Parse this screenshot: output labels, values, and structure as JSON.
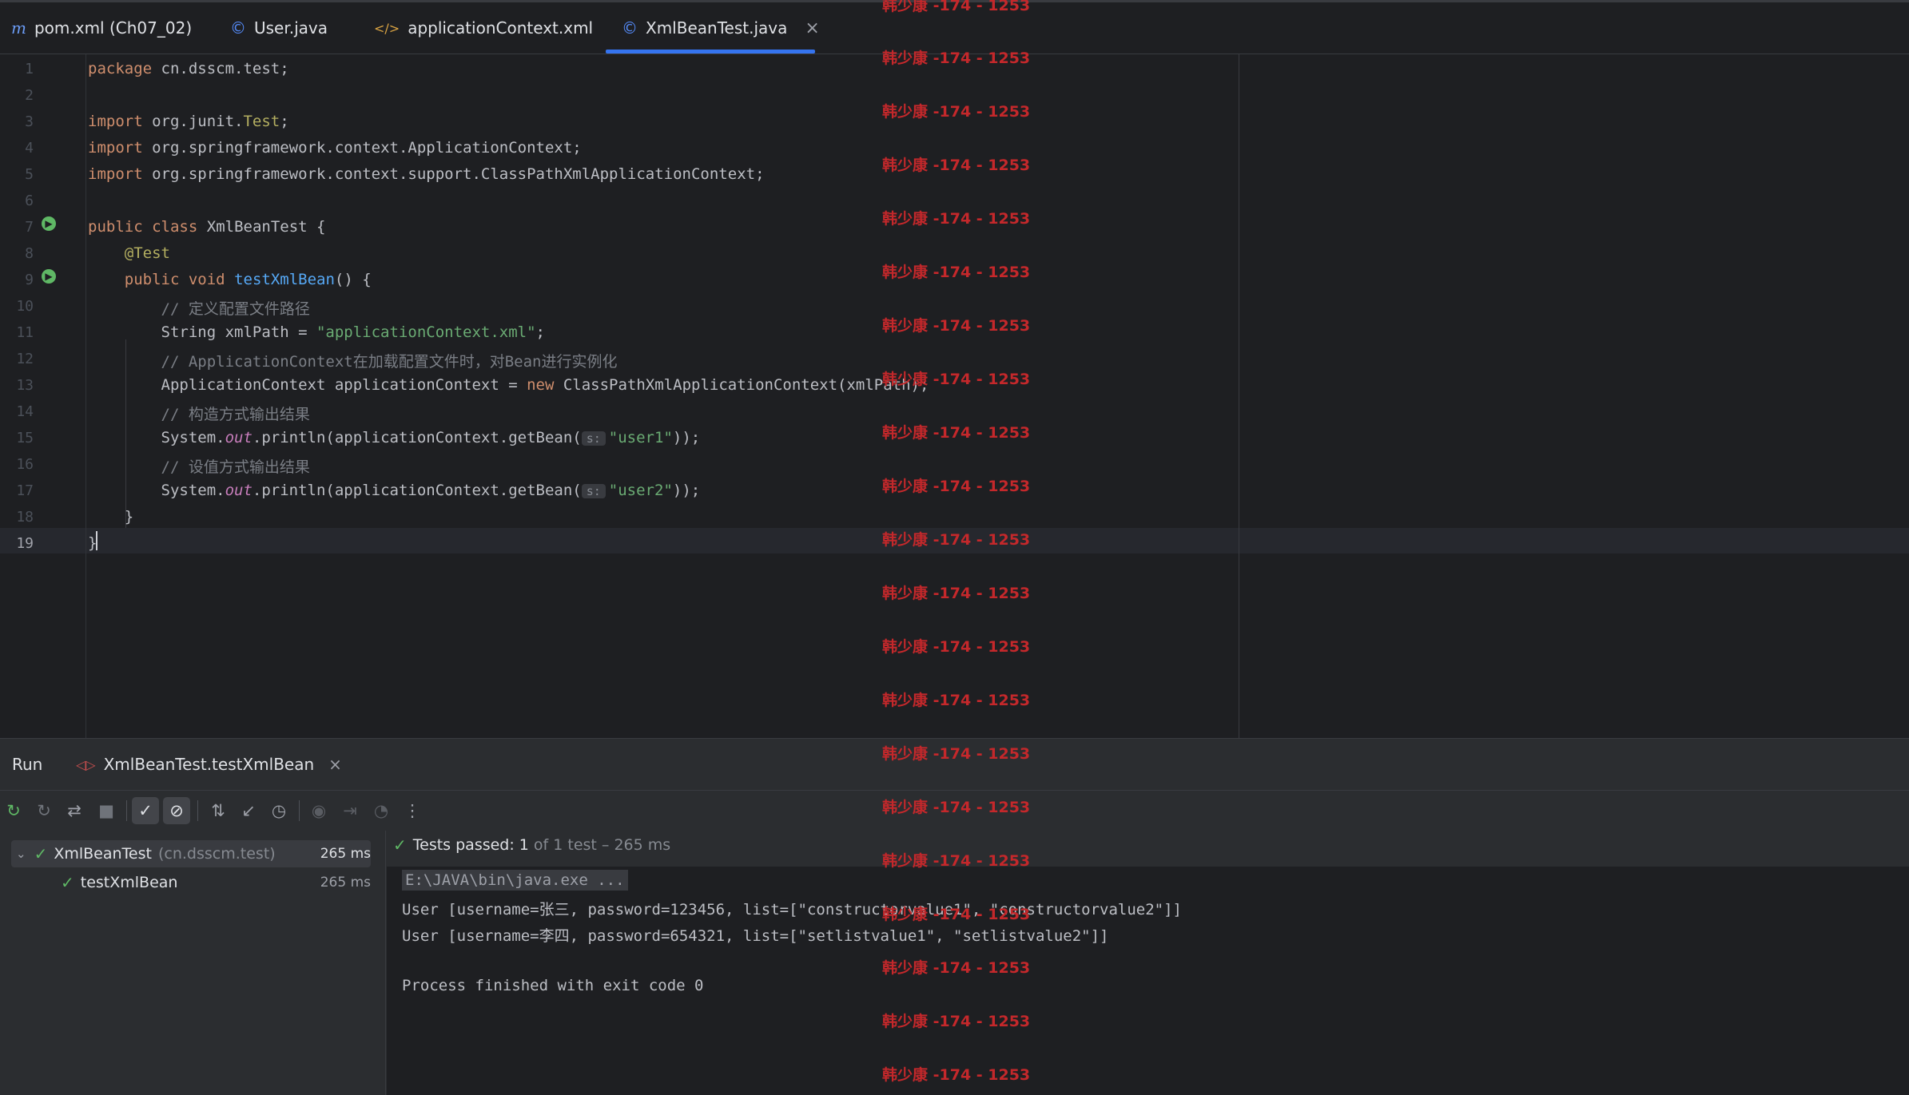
{
  "tabs": [
    {
      "icon": "m",
      "label": "pom.xml (Ch07_02)"
    },
    {
      "icon": "©",
      "label": "User.java"
    },
    {
      "icon": "</>",
      "label": "applicationContext.xml"
    },
    {
      "icon": "©",
      "label": "XmlBeanTest.java",
      "active": true,
      "close": "×"
    }
  ],
  "editor": {
    "line_numbers": [
      "1",
      "2",
      "3",
      "4",
      "5",
      "6",
      "7",
      "8",
      "9",
      "10",
      "11",
      "12",
      "13",
      "14",
      "15",
      "16",
      "17",
      "18",
      "19"
    ],
    "lines": {
      "l1": "cn.dsscm.test;",
      "l3": "org.junit.",
      "l3b": "Test",
      "l4": "org.springframework.context.ApplicationContext;",
      "l5": "org.springframework.context.support.ClassPathXmlApplicationContext;",
      "l7": "XmlBeanTest {",
      "l8": "@Test",
      "l9fn": "testXmlBean",
      "l9rest": "() {",
      "l10": "// 定义配置文件路径",
      "l11a": "String xmlPath = ",
      "l11s": "\"applicationContext.xml\"",
      "l11b": ";",
      "l12": "// ApplicationContext在加载配置文件时，对Bean进行实例化",
      "l13a": "ApplicationContext applicationContext = ",
      "l13b": "ClassPathXmlApplicationContext(xmlPath);",
      "l14": "// 构造方式输出结果",
      "l15a": "System.",
      "l15b": "out",
      "l15c": ".println(applicationContext.getBean(",
      "l15h": "s:",
      "l15s": "\"user1\"",
      "l15d": "));",
      "l16": "// 设值方式输出结果",
      "l17s": "\"user2\"",
      "l18": "}",
      "l19": "}"
    },
    "keywords": {
      "package": "package",
      "import": "import",
      "public": "public",
      "class": "class",
      "void": "void",
      "new": "new"
    }
  },
  "watermark": "韩少康 -174 - 1253",
  "run": {
    "title": "Run",
    "tab_label": "XmlBeanTest.testXmlBean",
    "tab_close": "×",
    "tree": [
      {
        "name": "XmlBeanTest",
        "pkg": "(cn.dsscm.test)",
        "ms": "265 ms"
      },
      {
        "name": "testXmlBean",
        "ms": "265 ms"
      }
    ],
    "status_passed": "Tests passed: 1",
    "status_rest": "of 1 test – 265 ms",
    "console": [
      "E:\\JAVA\\bin\\java.exe ...",
      "User [username=张三, password=123456, list=[\"constructorvalue1\", \"constructorvalue2\"]]",
      "User [username=李四, password=654321, list=[\"setlistvalue1\", \"setlistvalue2\"]]",
      "",
      "Process finished with exit code 0"
    ]
  },
  "colors": {
    "accent": "#3574f0",
    "pass": "#5fb865",
    "watermark": "#c4282b"
  }
}
